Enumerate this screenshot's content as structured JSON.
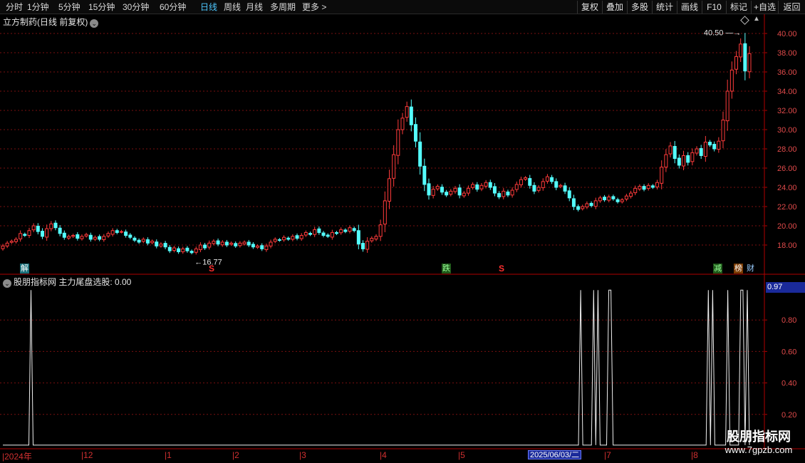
{
  "toolbar": {
    "periods": [
      {
        "label": "分时",
        "active": false
      },
      {
        "label": "1分钟",
        "active": false
      },
      {
        "label": "5分钟",
        "active": false
      },
      {
        "label": "15分钟",
        "active": false
      },
      {
        "label": "30分钟",
        "active": false
      },
      {
        "label": "60分钟",
        "active": false
      },
      {
        "label": "日线",
        "active": true
      },
      {
        "label": "周线",
        "active": false
      },
      {
        "label": "月线",
        "active": false
      },
      {
        "label": "多周期",
        "active": false
      },
      {
        "label": "更多 >",
        "active": false
      }
    ],
    "right_buttons": [
      "复权",
      "叠加",
      "多股",
      "统计",
      "画线",
      "F10",
      "标记",
      "+自选",
      "返回"
    ]
  },
  "stock": {
    "title": "立方制药(日线 前复权)",
    "high_label": "40.50",
    "low_label": "16.77"
  },
  "price_axis": [
    "40.00",
    "38.00",
    "36.00",
    "34.00",
    "32.00",
    "30.00",
    "28.00",
    "26.00",
    "24.00",
    "22.00",
    "20.00",
    "18.00"
  ],
  "markers": {
    "jie": "解",
    "die": "跌",
    "jian": "减",
    "bang": "榜",
    "cai": "财",
    "s1": "S",
    "s2": "S"
  },
  "indicator": {
    "title": "股朋指标网  主力尾盘选股: 0.00",
    "current_value": "0.97",
    "axis_labels": [
      "0.80",
      "0.60",
      "0.40",
      "0.20"
    ]
  },
  "date_axis": {
    "ticks": [
      "2024年",
      "12",
      "1",
      "2",
      "3",
      "4",
      "5",
      "7",
      "8"
    ],
    "cursor_label": "2025/06/03/二"
  },
  "watermark": {
    "brand": "股朋指标网",
    "url": "www.7gpzb.com"
  },
  "colors": {
    "up": "#ff3b3b",
    "down": "#54ffff",
    "grid": "#7a1010",
    "axis": "#b00000",
    "active_tab": "#4ec8ff"
  },
  "chart_data": [
    {
      "type": "candlestick",
      "title": "立方制药(日线 前复权)",
      "ylim": [
        16.5,
        41
      ],
      "y_ticks": [
        18,
        20,
        22,
        24,
        26,
        28,
        30,
        32,
        34,
        36,
        38,
        40
      ],
      "x_ticks": [
        "2024年",
        "12",
        "1",
        "2",
        "3",
        "4",
        "5",
        "7",
        "8"
      ],
      "annotations": [
        {
          "label": "40.50",
          "kind": "high"
        },
        {
          "label": "16.77",
          "kind": "low"
        }
      ],
      "closes": [
        17.9,
        18.2,
        18.4,
        18.6,
        19.2,
        19.0,
        19.5,
        20.0,
        19.4,
        18.9,
        19.7,
        20.2,
        19.8,
        19.2,
        18.8,
        18.9,
        19.0,
        18.7,
        18.9,
        19.1,
        18.6,
        18.8,
        18.6,
        18.9,
        19.2,
        19.5,
        19.3,
        19.4,
        19.0,
        18.8,
        18.5,
        18.3,
        18.6,
        18.2,
        18.4,
        17.9,
        18.1,
        17.8,
        17.4,
        17.7,
        17.3,
        17.6,
        17.4,
        17.2,
        17.6,
        18.0,
        17.7,
        18.2,
        18.4,
        18.1,
        18.3,
        18.0,
        18.2,
        17.9,
        18.2,
        18.3,
        18.0,
        17.8,
        17.9,
        17.6,
        17.9,
        18.3,
        18.6,
        18.5,
        18.8,
        18.6,
        18.9,
        18.7,
        19.0,
        19.3,
        19.1,
        19.6,
        19.3,
        19.0,
        18.9,
        19.3,
        19.2,
        19.6,
        19.4,
        19.8,
        19.5,
        18.1,
        17.6,
        18.4,
        18.7,
        18.9,
        20.1,
        22.6,
        24.9,
        27.4,
        30.0,
        31.2,
        32.4,
        30.5,
        28.8,
        26.2,
        24.3,
        23.2,
        23.8,
        24.1,
        23.5,
        23.2,
        23.6,
        23.9,
        23.2,
        23.4,
        23.9,
        24.3,
        23.8,
        24.2,
        24.5,
        24.0,
        23.4,
        23.0,
        23.6,
        23.2,
        23.7,
        24.3,
        24.8,
        25.0,
        24.2,
        23.6,
        24.0,
        24.6,
        25.1,
        24.6,
        24.0,
        24.2,
        23.6,
        22.9,
        22.0,
        21.7,
        22.0,
        22.3,
        22.1,
        22.6,
        22.9,
        22.7,
        23.0,
        22.8,
        22.5,
        22.7,
        23.1,
        23.4,
        23.9,
        24.1,
        23.8,
        24.2,
        24.0,
        24.5,
        26.1,
        27.4,
        28.3,
        27.0,
        26.3,
        27.3,
        26.6,
        27.6,
        28.0,
        27.3,
        28.7,
        28.4,
        28.0,
        28.8,
        31.0,
        34.0,
        36.2,
        37.6,
        38.9,
        36.1,
        37.9
      ]
    },
    {
      "type": "line",
      "title": "主力尾盘选股",
      "ylim": [
        0,
        1
      ],
      "y_ticks": [
        0.2,
        0.4,
        0.6,
        0.8
      ],
      "values": [
        0,
        0,
        0,
        0,
        0,
        0,
        0,
        0,
        0,
        0,
        0,
        0,
        0,
        1,
        0,
        0,
        0,
        0,
        0,
        0,
        0,
        0,
        0,
        0,
        0,
        0,
        0,
        0,
        0,
        0,
        0,
        0,
        0,
        0,
        0,
        0,
        0,
        0,
        0,
        0,
        0,
        0,
        0,
        0,
        0,
        0,
        0,
        0,
        0,
        0,
        0,
        0,
        0,
        0,
        0,
        0,
        0,
        0,
        0,
        0,
        0,
        0,
        0,
        0,
        0,
        0,
        0,
        0,
        0,
        0,
        0,
        0,
        0,
        0,
        0,
        0,
        0,
        0,
        0,
        0,
        0,
        0,
        0,
        0,
        0,
        0,
        0,
        0,
        0,
        0,
        0,
        0,
        0,
        0,
        0,
        0,
        0,
        0,
        0,
        0,
        0,
        0,
        0,
        0,
        0,
        0,
        0,
        0,
        0,
        0,
        0,
        0,
        0,
        0,
        0,
        0,
        0,
        0,
        0,
        0,
        0,
        0,
        0,
        0,
        0,
        0,
        0,
        0,
        0,
        0,
        0,
        0,
        0,
        0,
        0,
        0,
        0,
        0,
        0,
        0,
        0,
        0,
        0,
        0,
        0,
        0,
        0,
        0,
        0,
        0,
        0,
        0,
        0,
        0,
        0,
        0,
        0,
        0,
        0,
        0,
        0,
        0,
        0,
        0,
        0,
        0,
        0,
        0,
        0,
        0,
        0,
        0,
        0,
        0,
        0,
        0,
        0,
        0,
        0,
        0,
        0,
        0,
        0,
        0,
        0,
        0,
        0,
        0,
        0,
        0,
        0,
        0,
        0,
        0,
        0,
        0,
        0,
        0,
        0,
        0,
        0,
        0,
        0,
        0,
        0,
        0,
        0,
        0,
        0,
        0,
        0,
        0,
        0,
        0,
        0,
        0,
        0,
        0,
        0,
        0,
        0,
        0,
        0,
        0,
        0,
        0,
        0,
        0,
        0,
        0,
        0,
        0,
        0,
        0,
        0,
        0,
        0,
        0,
        0,
        0,
        0,
        0,
        0,
        0,
        0,
        0,
        0,
        0,
        0,
        0,
        0,
        0,
        0,
        0,
        0,
        0,
        0,
        0,
        0,
        0,
        0,
        0,
        0,
        0,
        0,
        0,
        0,
        1,
        0,
        0,
        0,
        0,
        0,
        1,
        0,
        1,
        0,
        0,
        0,
        0,
        1,
        1,
        0,
        0,
        0,
        0,
        0,
        0,
        0,
        0,
        0,
        0,
        0,
        0,
        0,
        0,
        0,
        0,
        0,
        0,
        0,
        0,
        0,
        0,
        0,
        0,
        0,
        0,
        0,
        0,
        0,
        0,
        0,
        0,
        0,
        0,
        0,
        0,
        0,
        0,
        0,
        0,
        0,
        0,
        0,
        0,
        1,
        0,
        1,
        0,
        0,
        0,
        0,
        0,
        0,
        1,
        0,
        0,
        0,
        0,
        0,
        1,
        1,
        0,
        1,
        0
      ]
    }
  ]
}
